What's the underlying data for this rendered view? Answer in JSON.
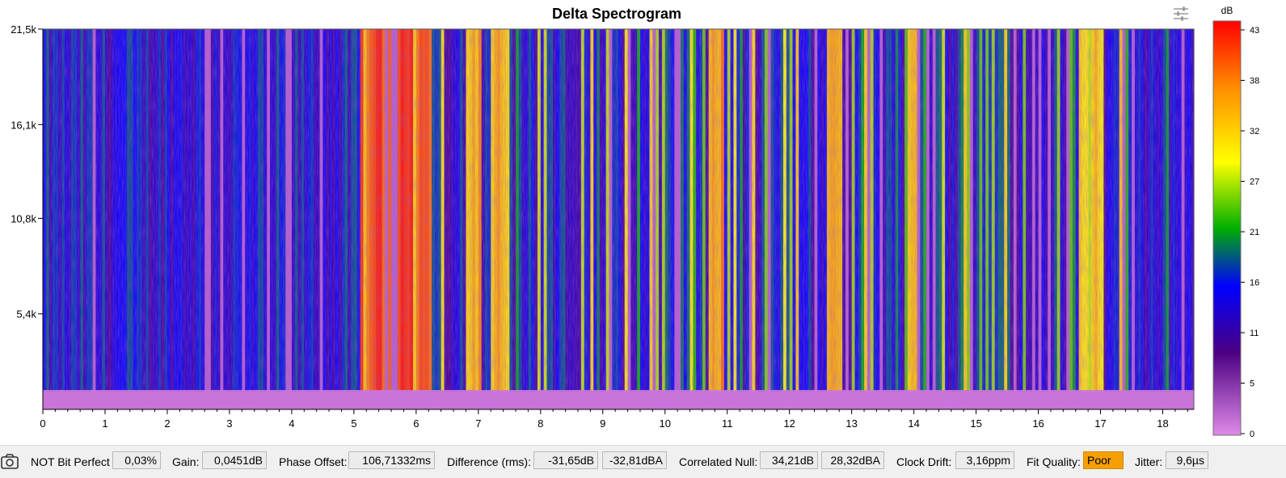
{
  "chart_data": {
    "type": "heatmap",
    "title": "Delta Spectrogram",
    "xlabel": "",
    "ylabel": "",
    "x_ticks": [
      "0",
      "1",
      "2",
      "3",
      "4",
      "5",
      "6",
      "7",
      "8",
      "9",
      "10",
      "11",
      "12",
      "13",
      "14",
      "15",
      "16",
      "17",
      "18"
    ],
    "xlim": [
      0,
      18.5
    ],
    "y_ticks": [
      {
        "label": "21,5k",
        "value": 21500
      },
      {
        "label": "16,1k",
        "value": 16100
      },
      {
        "label": "10,8k",
        "value": 10800
      },
      {
        "label": "5,4k",
        "value": 5400
      }
    ],
    "ylim": [
      0,
      21500
    ],
    "colorbar": {
      "label": "dB",
      "ticks": [
        "43",
        "38",
        "32",
        "27",
        "21",
        "16",
        "11",
        "5",
        "0"
      ],
      "range": [
        0,
        43
      ],
      "colors": [
        "#ff0000",
        "#ff8c00",
        "#ffff00",
        "#00b000",
        "#0000ff",
        "#4b0082",
        "#e08ae8"
      ]
    },
    "grid": false,
    "high_energy_segments": [
      {
        "start": 5.1,
        "end": 6.2,
        "level": 42
      },
      {
        "start": 6.8,
        "end": 7.0,
        "level": 36
      },
      {
        "start": 7.2,
        "end": 7.4,
        "level": 36
      },
      {
        "start": 10.7,
        "end": 10.9,
        "level": 38
      },
      {
        "start": 12.6,
        "end": 12.8,
        "level": 36
      },
      {
        "start": 13.9,
        "end": 14.1,
        "level": 35
      },
      {
        "start": 16.7,
        "end": 17.0,
        "level": 33
      }
    ],
    "noise_floor_level": 8
  },
  "status": {
    "bit_perfect_label": "NOT Bit Perfect",
    "bit_perfect_value": "0,03%",
    "gain_label": "Gain:",
    "gain_value": "0,0451dB",
    "phase_label": "Phase Offset:",
    "phase_value": "106,71332ms",
    "difference_label": "Difference (rms):",
    "difference_db": "-31,65dB",
    "difference_dba": "-32,81dBA",
    "null_label": "Correlated Null:",
    "null_db": "34,21dB",
    "null_dba": "28,32dBA",
    "drift_label": "Clock Drift:",
    "drift_value": "3,16ppm",
    "fit_label": "Fit Quality:",
    "fit_value": "Poor",
    "jitter_label": "Jitter:",
    "jitter_value": "9,6µs"
  },
  "icons": {
    "settings": "sliders-icon",
    "camera": "camera-icon"
  }
}
